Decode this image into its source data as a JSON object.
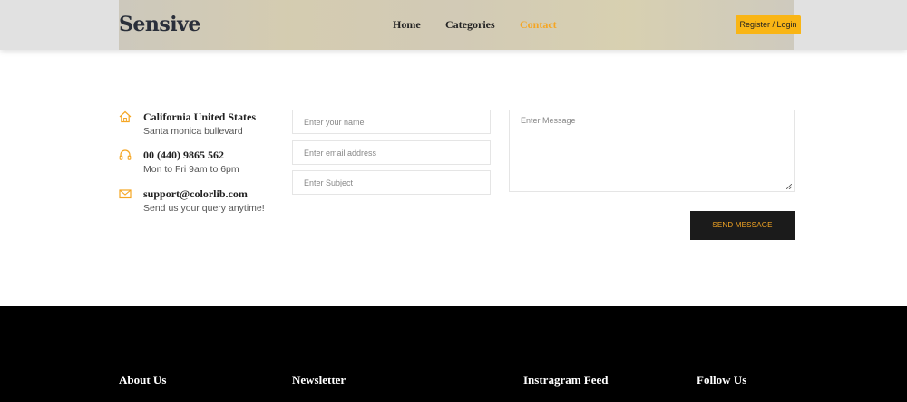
{
  "header": {
    "logo": "Sensive",
    "nav": [
      {
        "label": "Home",
        "active": false
      },
      {
        "label": "Categories",
        "active": false
      },
      {
        "label": "Contact",
        "active": true
      }
    ],
    "register_label": "Register / Login"
  },
  "contact_info": [
    {
      "icon": "home-icon",
      "title": "California United States",
      "subtitle": "Santa monica bullevard"
    },
    {
      "icon": "headphones-icon",
      "title": "00 (440) 9865 562",
      "subtitle": "Mon to Fri 9am to 6pm"
    },
    {
      "icon": "mail-icon",
      "title": "support@colorlib.com",
      "subtitle": "Send us your query anytime!"
    }
  ],
  "form": {
    "name_placeholder": "Enter your name",
    "email_placeholder": "Enter email address",
    "subject_placeholder": "Enter Subject",
    "message_placeholder": "Enter Message",
    "send_label": "SEND MESSAGE"
  },
  "footer": {
    "headings": [
      "About Us",
      "Newsletter",
      "Instragram Feed",
      "Follow Us"
    ]
  },
  "colors": {
    "accent": "#f5a623",
    "button_yellow": "#f9b515",
    "footer_bg": "#000000"
  }
}
